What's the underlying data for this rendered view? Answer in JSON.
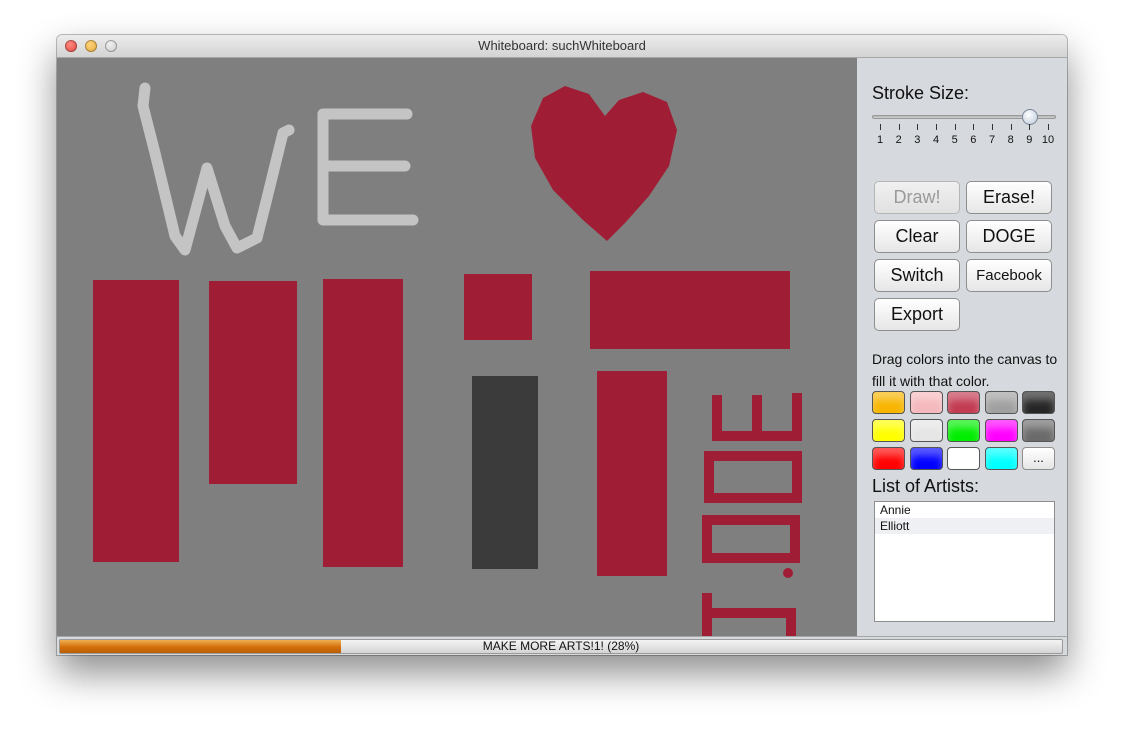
{
  "window": {
    "title": "Whiteboard: suchWhiteboard"
  },
  "canvas": {
    "background": "#7f7f7f",
    "ink_red": "#a01e35",
    "ink_light": "#c4c4c4",
    "ink_dark": "#3b3b3b"
  },
  "panel": {
    "stroke_size_label": "Stroke Size:",
    "stroke_size": {
      "value": 9,
      "min": 1,
      "max": 10,
      "ticks": [
        "1",
        "2",
        "3",
        "4",
        "5",
        "6",
        "7",
        "8",
        "9",
        "10"
      ]
    },
    "buttons": {
      "draw": "Draw!",
      "erase": "Erase!",
      "clear": "Clear",
      "doge": "DOGE",
      "switch": "Switch",
      "facebook": "Facebook",
      "export": "Export"
    },
    "hint": "Drag colors into the canvas to fill it with that color.",
    "swatches": [
      "#f7b500",
      "#f5b8bc",
      "#c23b52",
      "#a0a0a0",
      "#262626",
      "#ffff00",
      "#e5e5e5",
      "#00ee00",
      "#ff00ff",
      "#6b6b6b",
      "#ff0000",
      "#0000ff",
      "#ffffff",
      "#00ffff"
    ],
    "more_colors_label": "...",
    "artists_label": "List of Artists:",
    "artists": [
      "Annie",
      "Elliott"
    ]
  },
  "status": {
    "text": "MAKE MORE ARTS!1! (28%)",
    "progress": 0.28,
    "color": "#d46f0a"
  }
}
